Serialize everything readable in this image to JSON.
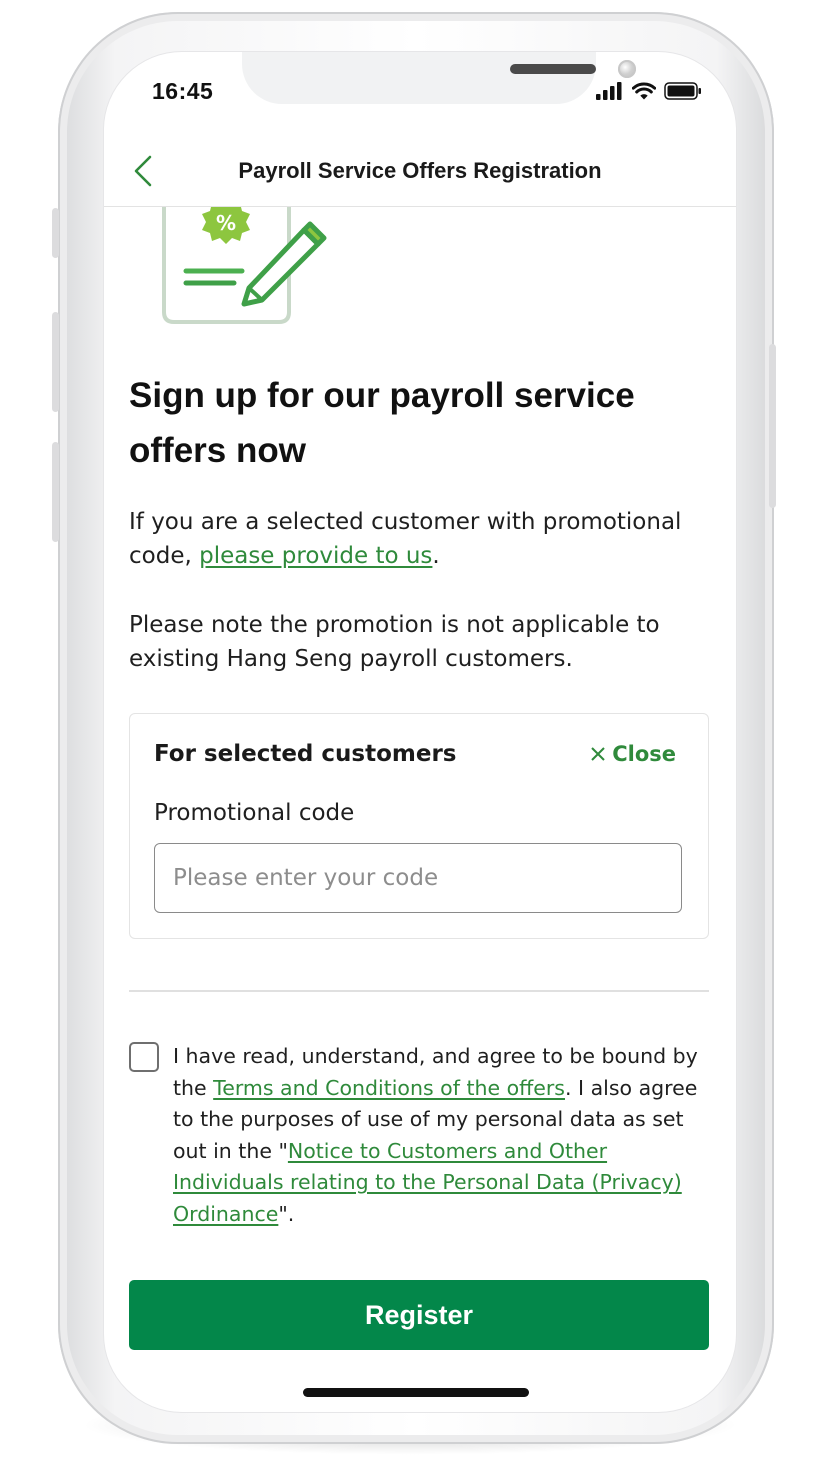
{
  "status_bar": {
    "time": "16:45",
    "icons": [
      "cellular-signal-icon",
      "wifi-icon",
      "battery-icon"
    ]
  },
  "header": {
    "title": "Payroll Service Offers Registration",
    "back_icon": "chevron-left-icon"
  },
  "hero": {
    "illustration": "form-with-pencil-and-percent-badge-icon",
    "badge_symbol": "%"
  },
  "main": {
    "headline": "Sign up for our payroll service offers now",
    "para1_prefix": "If you are a selected customer with promotional code, ",
    "para1_link": "please provide to us",
    "para1_suffix": ".",
    "para2": "Please note the promotion is not applicable to existing Hang Seng payroll customers."
  },
  "promo": {
    "title": "For selected customers",
    "close_label": "Close",
    "field_label": "Promotional code",
    "placeholder": "Please enter your code",
    "value": ""
  },
  "consent": {
    "checked": false,
    "text1": "I have read, understand, and agree to be bound by the ",
    "link1": "Terms and Conditions of the offers",
    "text2": ". I also agree to the purposes of use of my personal data as set out in the \"",
    "link2": "Notice to Customers and Other Individuals relating to the Personal Data (Privacy) Ordinance",
    "text3": "\"."
  },
  "actions": {
    "register_label": "Register"
  },
  "colors": {
    "brand_green": "#03874a",
    "link_green": "#2f8a3b",
    "illustration_light_green": "#8dc63f"
  }
}
